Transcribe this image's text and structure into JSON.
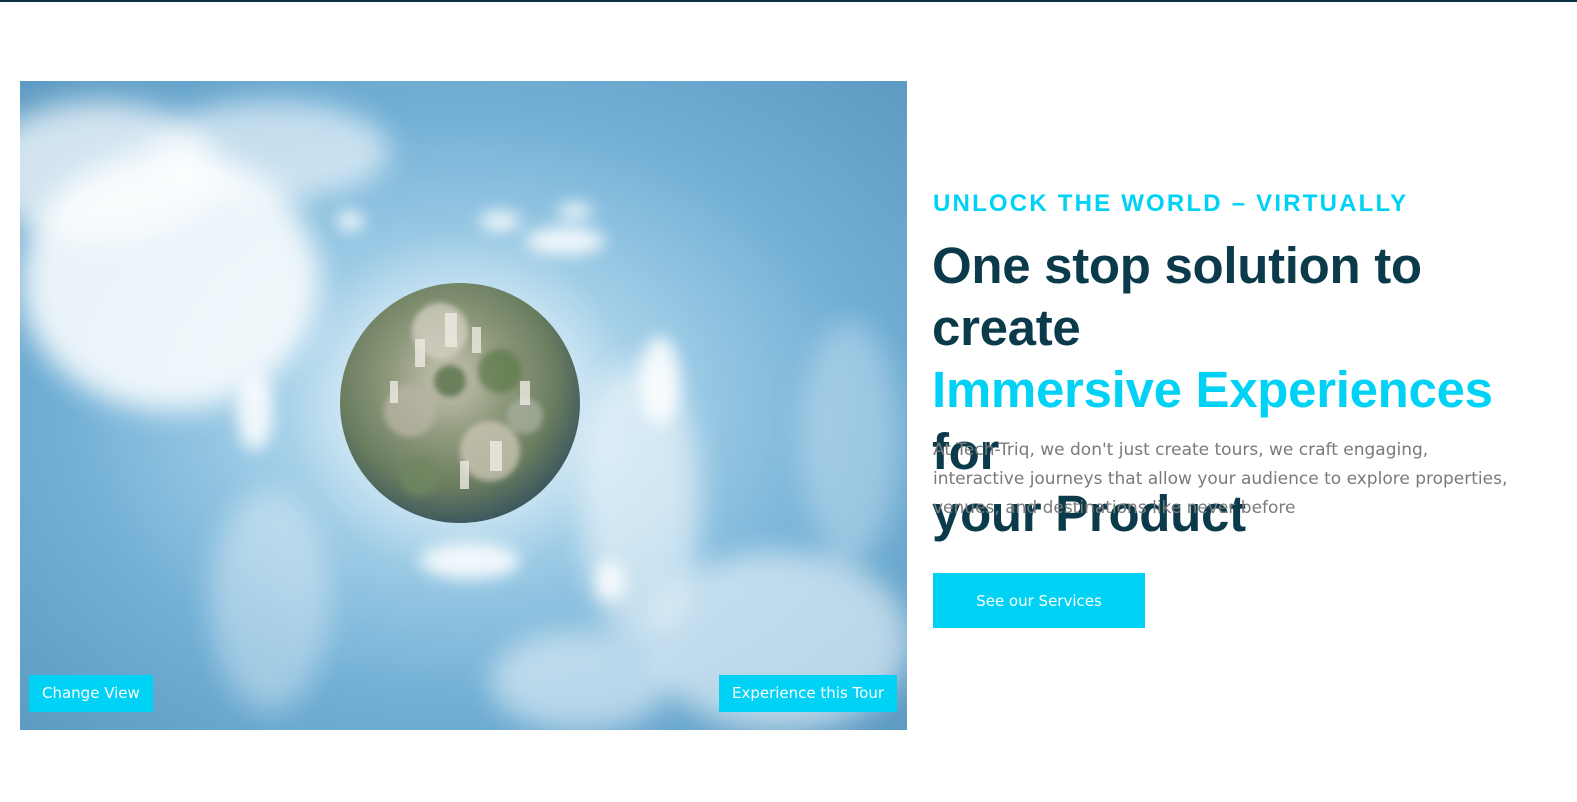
{
  "hero": {
    "media": {
      "change_view_label": "Change View",
      "experience_tour_label": "Experience this Tour"
    },
    "eyebrow": "UNLOCK THE WORLD – VIRTUALLY",
    "headline": {
      "line1": "One stop solution to create",
      "accent": "Immersive Experiences",
      "line2_rest": " for",
      "line3": "your Product"
    },
    "description": "At Tech-Triq, we don't just create tours, we craft engaging, interactive journeys that allow your audience to explore properties, venues, and destinations like never before",
    "cta_label": "See our Services"
  },
  "colors": {
    "accent": "#00d2f5",
    "heading": "#0b3b4b",
    "body_text": "#7a7a7a"
  }
}
